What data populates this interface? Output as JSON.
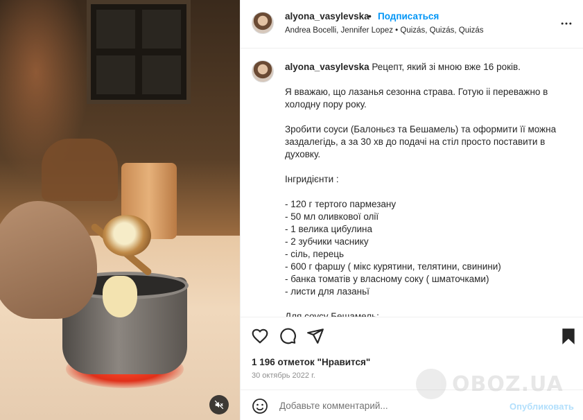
{
  "header": {
    "username": "alyona_vasylevska",
    "separator": "•",
    "follow_label": "Подписаться",
    "audio": "Andrea Bocelli, Jennifer Lopez • Quizás, Quizás, Quizás"
  },
  "caption": {
    "username": "alyona_vasylevska",
    "lines": [
      "Рецепт, який зі мною вже 16 років.",
      "",
      "Я вважаю, що лазанья сезонна страва. Готую іі переважно в холодну пору року.",
      "",
      "Зробити соуси (Балоньєз та Бешамель) та оформити її можна заздалегідь, а за 30 хв до подачі на стіл просто поставити в духовку.",
      "",
      "Інгридієнти :",
      "",
      "- 120 г тертого пармезану",
      "- 50 мл оливкової олії",
      "- 1 велика цибулина",
      "- 2 зубчики часнику",
      "- сіль, перець",
      "- 600 г фаршу ( мікс курятини, телятини, свинини)",
      "- банка томатів у власному соку ( шматочками)",
      "- листи для лазаньї",
      "",
      "Для соусу Бешамель:"
    ]
  },
  "actions": {
    "icons": [
      "heart-icon",
      "comment-icon",
      "share-icon",
      "bookmark-icon"
    ],
    "likes": "1 196 отметок \"Нравится\"",
    "date": "30 октябрь 2022 г."
  },
  "comment": {
    "placeholder": "Добавьте комментарий...",
    "publish_label": "Опубликовать"
  },
  "watermark": {
    "text": "OBOZ.UA"
  },
  "colors": {
    "accent": "#0095f6",
    "publish_disabled": "#b2dffc",
    "text": "#262626",
    "muted": "#8e8e8e",
    "divider": "#efefef"
  }
}
